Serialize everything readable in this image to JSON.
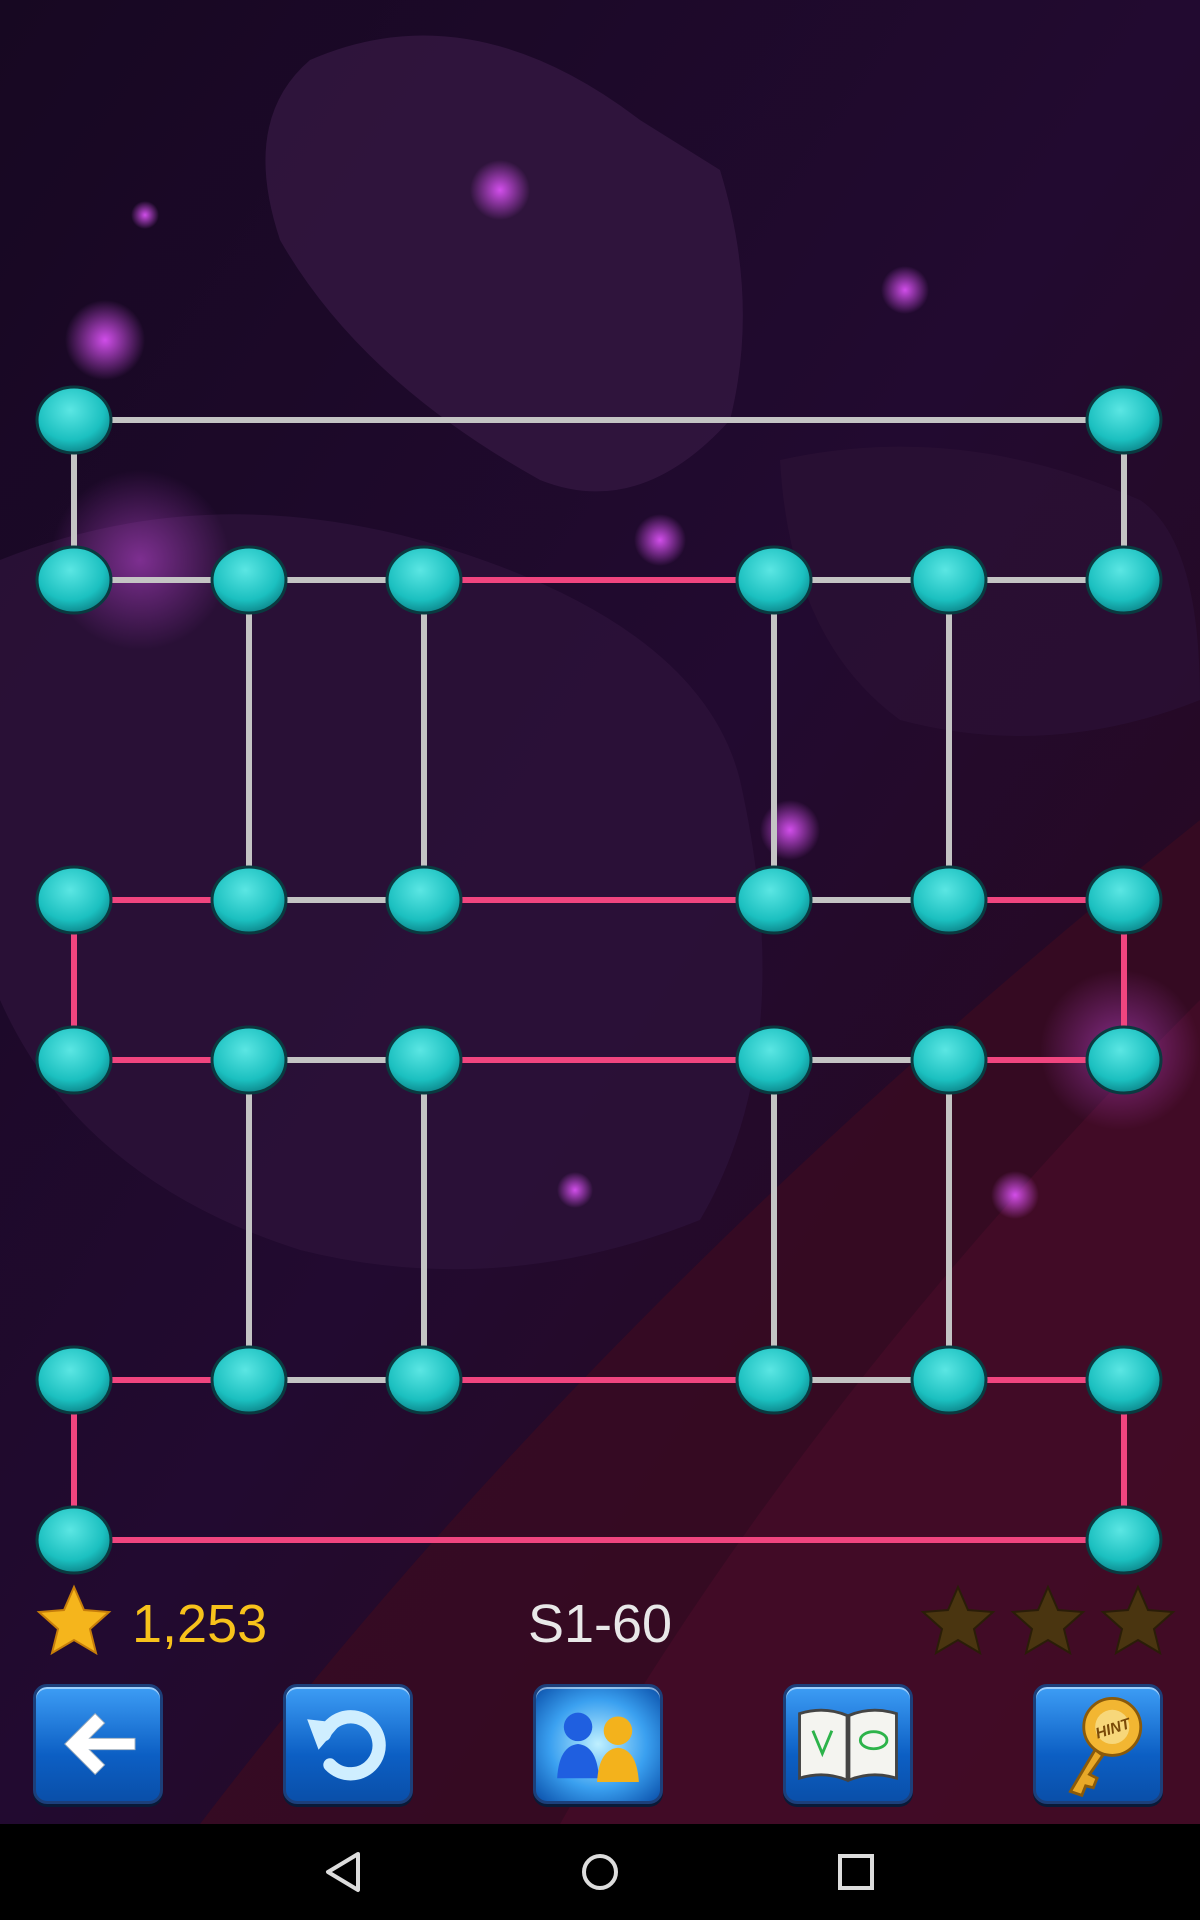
{
  "game": {
    "score": "1,253",
    "level": "S1-60",
    "stars_earned": 0,
    "stars_total": 3
  },
  "colors": {
    "node": "#1bc0c0",
    "edge_unvisited": "#c4c4c4",
    "edge_visited": "#f0457f",
    "score_text": "#f7c21b",
    "button_blue": "#1a75e0",
    "star_filled": "#f5b51c",
    "star_empty": "#4a3510"
  },
  "toolbar": [
    {
      "name": "back-button",
      "icon": "arrow-left-icon"
    },
    {
      "name": "undo-button",
      "icon": "undo-icon"
    },
    {
      "name": "multiplayer-button",
      "icon": "two-players-icon"
    },
    {
      "name": "guide-button",
      "icon": "open-book-icon"
    },
    {
      "name": "hint-button",
      "icon": "hint-key-icon",
      "label": "HINT"
    }
  ],
  "system_nav": [
    {
      "name": "nav-back-button",
      "icon": "triangle-back-icon"
    },
    {
      "name": "nav-home-button",
      "icon": "circle-home-icon"
    },
    {
      "name": "nav-recents-button",
      "icon": "square-recents-icon"
    }
  ]
}
